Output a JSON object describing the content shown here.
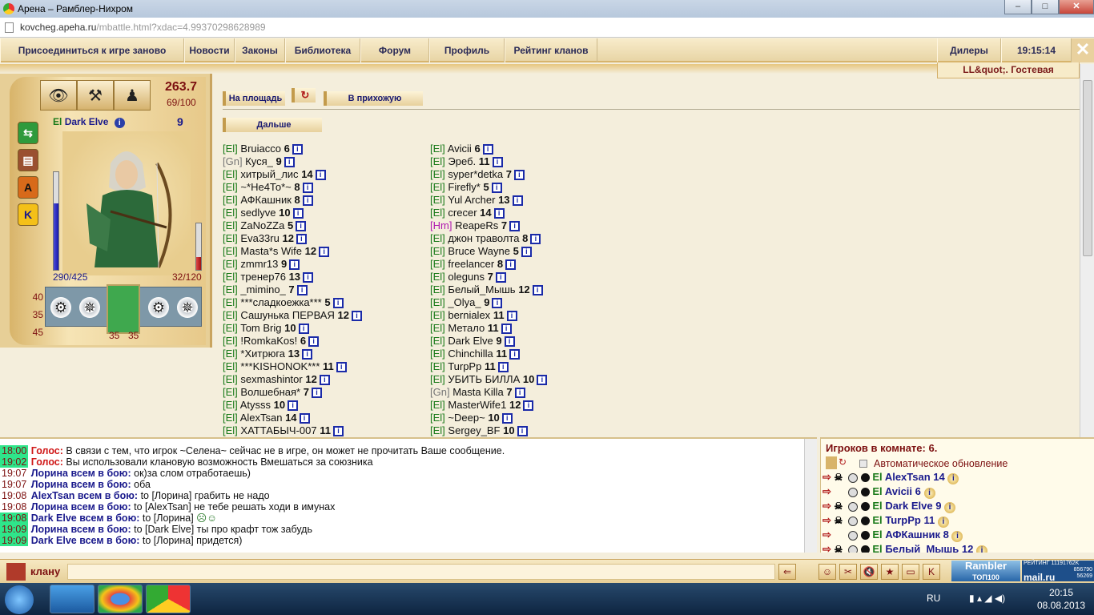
{
  "window": {
    "title": "Арена – Рамблер-Нихром",
    "url_host": "kovcheg.apeha.ru",
    "url_path": "/mbattle.html?xdac=4.99370298628989"
  },
  "menu": {
    "rejoin": "Присоединиться к игре заново",
    "news": "Новости",
    "laws": "Законы",
    "library": "Библиотека",
    "forum": "Форум",
    "profile": "Профиль",
    "clan_rating": "Рейтинг кланов",
    "dealers": "Дилеры",
    "time": "19:15:14"
  },
  "room_tab": "LL&quot;. Гостевая",
  "character": {
    "score": "263.7",
    "score_sub": "69/100",
    "clan": "El",
    "name": "Dark Elve",
    "level": "9",
    "hp": "290/425",
    "mp": "32/120",
    "hp_fraction": 0.68,
    "mp_fraction": 0.27,
    "stats": [
      "40",
      "35",
      "45"
    ],
    "armor_left": "35",
    "armor_right": "35",
    "side_icons": [
      "map-icon",
      "book-icon",
      "A",
      "K"
    ]
  },
  "lobby": {
    "to_square": "На площадь",
    "refresh_icon": "↻",
    "to_hall": "В прихожую",
    "further": "Дальше",
    "left_column": [
      {
        "tag": "[El]",
        "name": "Bruiacco",
        "level": "6"
      },
      {
        "tag": "[Gn]",
        "name": "Куся_",
        "level": "9"
      },
      {
        "tag": "[El]",
        "name": "хитрый_лис",
        "level": "14"
      },
      {
        "tag": "[El]",
        "name": "~*Не4То*~",
        "level": "8"
      },
      {
        "tag": "[El]",
        "name": "АФКашник",
        "level": "8"
      },
      {
        "tag": "[El]",
        "name": "sedlyve",
        "level": "10"
      },
      {
        "tag": "[El]",
        "name": "ZaNoZZa",
        "level": "5"
      },
      {
        "tag": "[El]",
        "name": "Eva33ru",
        "level": "12"
      },
      {
        "tag": "[El]",
        "name": "Masta*s Wife",
        "level": "12"
      },
      {
        "tag": "[El]",
        "name": "zmmr13",
        "level": "9"
      },
      {
        "tag": "[El]",
        "name": "тренер76",
        "level": "13"
      },
      {
        "tag": "[El]",
        "name": "_mimino_",
        "level": "7"
      },
      {
        "tag": "[El]",
        "name": "***сладкоежка***",
        "level": "5"
      },
      {
        "tag": "[El]",
        "name": "Сашунька ПЕРВАЯ",
        "level": "12"
      },
      {
        "tag": "[El]",
        "name": "Tom Brig",
        "level": "10"
      },
      {
        "tag": "[El]",
        "name": "!RomkaKos!",
        "level": "6"
      },
      {
        "tag": "[El]",
        "name": "*Хитрюга",
        "level": "13"
      },
      {
        "tag": "[El]",
        "name": "***KISHONOK***",
        "level": "11"
      },
      {
        "tag": "[El]",
        "name": "sexmashintor",
        "level": "12"
      },
      {
        "tag": "[El]",
        "name": "Волшебная*",
        "level": "7"
      },
      {
        "tag": "[El]",
        "name": "Atysss",
        "level": "10"
      },
      {
        "tag": "[El]",
        "name": "AlexTsan",
        "level": "14"
      },
      {
        "tag": "[El]",
        "name": "ХАТТАБЫЧ-007",
        "level": "11"
      }
    ],
    "right_column": [
      {
        "tag": "[El]",
        "name": "Avicii",
        "level": "6"
      },
      {
        "tag": "[El]",
        "name": "Эреб.",
        "level": "11"
      },
      {
        "tag": "[El]",
        "name": "syper*detka",
        "level": "7"
      },
      {
        "tag": "[El]",
        "name": "Firefly*",
        "level": "5"
      },
      {
        "tag": "[El]",
        "name": "Yul Archer",
        "level": "13"
      },
      {
        "tag": "[El]",
        "name": "crecer",
        "level": "14"
      },
      {
        "tag": "[Hm]",
        "name": "ReapeRs",
        "level": "7"
      },
      {
        "tag": "[El]",
        "name": "джон траволта",
        "level": "8"
      },
      {
        "tag": "[El]",
        "name": "Bruce Wayne",
        "level": "5"
      },
      {
        "tag": "[El]",
        "name": "freelancer",
        "level": "8"
      },
      {
        "tag": "[El]",
        "name": "oleguns",
        "level": "7"
      },
      {
        "tag": "[El]",
        "name": "Белый_Мышь",
        "level": "12"
      },
      {
        "tag": "[El]",
        "name": "_Olya_",
        "level": "9"
      },
      {
        "tag": "[El]",
        "name": "bernialex",
        "level": "11"
      },
      {
        "tag": "[El]",
        "name": "Метало",
        "level": "11"
      },
      {
        "tag": "[El]",
        "name": "Dark Elve",
        "level": "9"
      },
      {
        "tag": "[El]",
        "name": "Chinchilla",
        "level": "11"
      },
      {
        "tag": "[El]",
        "name": "TurpPp",
        "level": "11"
      },
      {
        "tag": "[El]",
        "name": "УБИТЬ БИЛЛА",
        "level": "10"
      },
      {
        "tag": "[Gn]",
        "name": "Masta Killa",
        "level": "7"
      },
      {
        "tag": "[El]",
        "name": "MasterWife1",
        "level": "12"
      },
      {
        "tag": "[El]",
        "name": "~Deep~",
        "level": "10"
      },
      {
        "tag": "[El]",
        "name": "Sergey_BF",
        "level": "10"
      }
    ]
  },
  "chat": [
    {
      "time": "18:00",
      "hl": true,
      "from": "Голос:",
      "sys": true,
      "text": "В связи с тем, что игрок ~Селена~ сейчас не в игре, он может не прочитать Ваше сообщение."
    },
    {
      "time": "19:02",
      "hl": true,
      "from": "Голос:",
      "sys": true,
      "text": "Вы использовали клановую возможность Вмешаться за союзника"
    },
    {
      "time": "19:07",
      "hl": false,
      "from": "Лорина всем в бою:",
      "sys": false,
      "text": "ок)за слом отработаешь)"
    },
    {
      "time": "19:07",
      "hl": false,
      "from": "Лорина всем в бою:",
      "sys": false,
      "text": "оба"
    },
    {
      "time": "19:08",
      "hl": false,
      "from": "AlexTsan всем в бою:",
      "sys": false,
      "text": "to [Лорина] грабить не надо"
    },
    {
      "time": "19:08",
      "hl": false,
      "from": "Лорина всем в бою:",
      "sys": false,
      "text": "to [AlexTsan] не тебе решать ходи в имунах"
    },
    {
      "time": "19:08",
      "hl": true,
      "from": "Dark Elve всем в бою:",
      "sys": false,
      "text": "to [Лорина]"
    },
    {
      "time": "19:09",
      "hl": true,
      "from": "Лорина всем в бою:",
      "sys": false,
      "text": "to [Dark Elve] ты про крафт тож забудь"
    },
    {
      "time": "19:09",
      "hl": true,
      "from": "Dark Elve всем в бою:",
      "sys": false,
      "text": "to [Лорина] придется)"
    }
  ],
  "room": {
    "title": "Игроков в комнате: 6.",
    "auto_update": "Автоматическое обновление",
    "players": [
      {
        "tag": "El",
        "name": "AlexTsan",
        "level": "14"
      },
      {
        "tag": "El",
        "name": "Avicii",
        "level": "6"
      },
      {
        "tag": "El",
        "name": "Dark Elve",
        "level": "9"
      },
      {
        "tag": "El",
        "name": "TurpPp",
        "level": "11"
      },
      {
        "tag": "El",
        "name": "АФКашник",
        "level": "8"
      },
      {
        "tag": "El",
        "name": "Белый_Мышь",
        "level": "12"
      }
    ]
  },
  "input": {
    "channel": "клану",
    "value": ""
  },
  "badges": {
    "rambler_top": "Rambler",
    "rambler_sub": "ТОП100",
    "mailru_line1": "РЕЙТИНГ 11191762K",
    "mailru_line2": "856790",
    "mailru_line3": "56269",
    "mailru_brand": "mail.ru"
  },
  "taskbar": {
    "lang": "RU",
    "time": "20:15",
    "date": "08.08.2013"
  }
}
